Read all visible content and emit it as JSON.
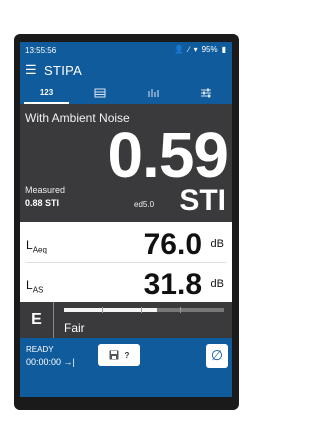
{
  "status_bar": {
    "time": "13:55:56",
    "battery": "95%",
    "icons": [
      "person-icon",
      "link-icon",
      "wifi-icon",
      "battery-icon"
    ]
  },
  "app_bar": {
    "title": "STIPA",
    "menu_icon": "hamburger-menu-icon"
  },
  "tabs": [
    {
      "label": "123",
      "active": true
    },
    {
      "icon": "list-icon",
      "active": false
    },
    {
      "icon": "spectrum-icon",
      "active": false
    },
    {
      "icon": "sliders-icon",
      "active": false
    }
  ],
  "result": {
    "condition": "With Ambient Noise",
    "value": "0.59",
    "unit": "STI",
    "measured_label": "Measured",
    "measured_value": "0.88 STI",
    "edition": "ed5.0"
  },
  "levels": [
    {
      "name": "L",
      "sub": "Aeq",
      "value": "76.0",
      "unit": "dB"
    },
    {
      "name": "L",
      "sub": "AS",
      "value": "31.8",
      "unit": "dB"
    }
  ],
  "rating": {
    "grade": "E",
    "label": "Fair",
    "level_fraction": 0.58
  },
  "bottom": {
    "state": "READY",
    "elapsed": "00:00:00",
    "save_help_label": "?",
    "save_icon": "save-icon",
    "clear_icon": "clear-icon"
  },
  "colors": {
    "accent": "#0f5b9c",
    "panel": "#3a3a3d"
  }
}
